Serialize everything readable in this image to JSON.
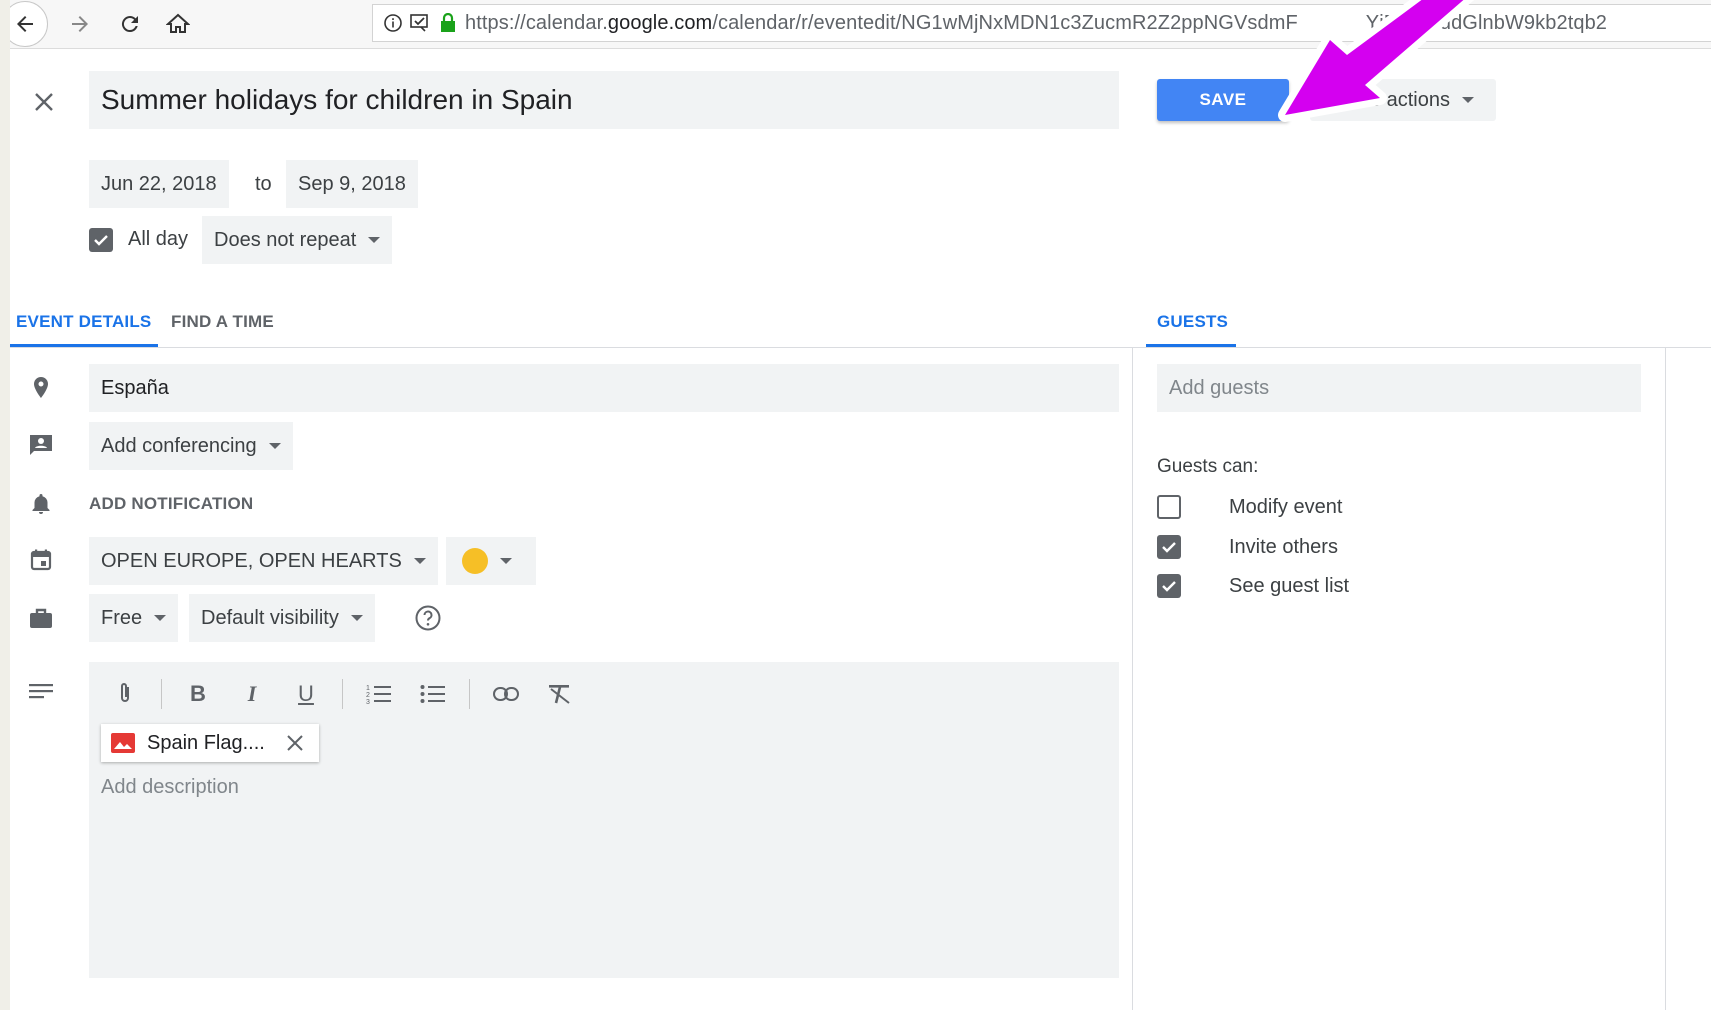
{
  "browser": {
    "url_prefix": "https://calendar.",
    "url_domain": "google.com",
    "url_path": "/calendar/r/eventedit/NG1wMjNxMDN1c3ZucmR2Z2ppNGVsdmF",
    "url_tail": "YjE2czhudGlnbW9kb2tqb2"
  },
  "event": {
    "title": "Summer holidays for children in Spain",
    "start_date": "Jun 22, 2018",
    "to_label": "to",
    "end_date": "Sep 9, 2018",
    "all_day_label": "All day",
    "repeat": "Does not repeat"
  },
  "actions": {
    "save": "SAVE",
    "more_actions": "re actions"
  },
  "tabs": {
    "event_details": "EVENT DETAILS",
    "find_a_time": "FIND A TIME",
    "guests": "GUESTS"
  },
  "details": {
    "location": "España",
    "conferencing": "Add conferencing",
    "add_notification": "ADD NOTIFICATION",
    "calendar": "OPEN EUROPE, OPEN HEARTS",
    "event_color": "#f6bf26",
    "availability": "Free",
    "visibility": "Default visibility"
  },
  "description": {
    "attachment_name": "Spain Flag....",
    "placeholder": "Add description"
  },
  "guests": {
    "input_placeholder": "Add guests",
    "guests_can_label": "Guests can:",
    "permissions": [
      {
        "label": "Modify event",
        "checked": false
      },
      {
        "label": "Invite others",
        "checked": true
      },
      {
        "label": "See guest list",
        "checked": true
      }
    ]
  },
  "colors": {
    "accent": "#1a73e8",
    "save_button": "#4285f4",
    "annotation_arrow": "#d400f0"
  }
}
